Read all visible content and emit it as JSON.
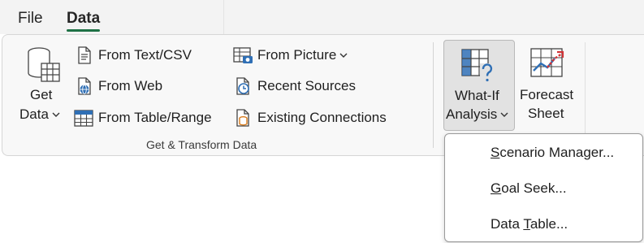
{
  "tabs": {
    "file": "File",
    "data": "Data"
  },
  "get_data": {
    "line1": "Get",
    "line2": "Data",
    "icon": "database-table-icon"
  },
  "import_buttons": [
    {
      "label": "From Text/CSV",
      "icon": "text-file-icon"
    },
    {
      "label": "From Web",
      "icon": "web-page-icon"
    },
    {
      "label": "From Table/Range",
      "icon": "table-range-icon"
    },
    {
      "label": "From Picture",
      "icon": "picture-table-icon",
      "has_dropdown": true
    },
    {
      "label": "Recent Sources",
      "icon": "recent-clock-icon"
    },
    {
      "label": "Existing Connections",
      "icon": "connections-icon"
    }
  ],
  "group_label": "Get & Transform Data",
  "what_if": {
    "line1": "What-If",
    "line2": "Analysis",
    "pressed": true
  },
  "forecast": {
    "line1": "Forecast",
    "line2": "Sheet"
  },
  "menu": {
    "items": [
      {
        "accel": "S",
        "rest": "cenario Manager..."
      },
      {
        "accel": "G",
        "rest": "oal Seek..."
      },
      {
        "pre": "Data ",
        "accel": "T",
        "rest": "able..."
      }
    ]
  },
  "colors": {
    "accent_green": "#1e7145",
    "icon_blue": "#2f6fb5",
    "icon_orange": "#d87a1a",
    "icon_red": "#d13438"
  }
}
